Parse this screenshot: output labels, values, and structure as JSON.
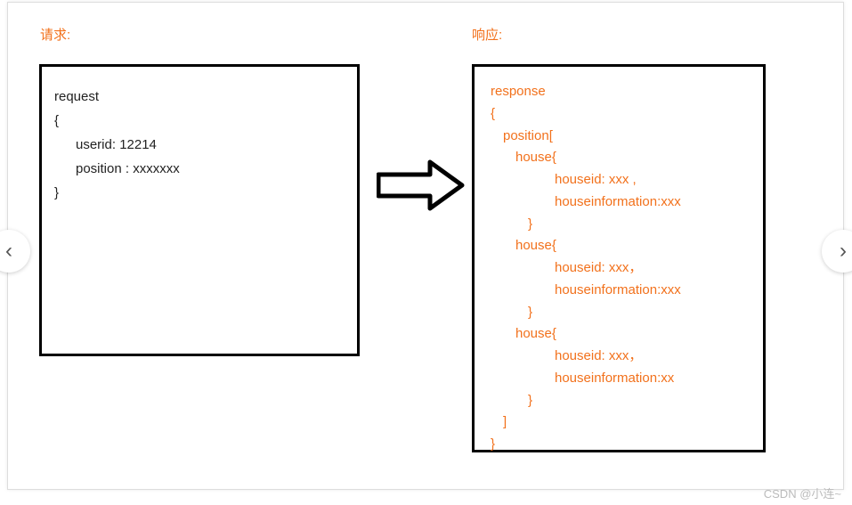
{
  "labels": {
    "request": "请求:",
    "response": "响应:"
  },
  "request": {
    "title": "request",
    "open": "{",
    "userid_line": "userid:  12214",
    "position_line": "position :  xxxxxxx",
    "close": "}"
  },
  "response": {
    "title": "response",
    "open": "{",
    "pos_open": "position[",
    "house1_open": "house{",
    "house1_id": "houseid: xxx ,",
    "house1_info": "houseinformation:xxx",
    "house1_close": "}",
    "house2_open": "house{",
    "house2_id": "houseid: xxx，",
    "house2_info": "houseinformation:xxx",
    "house2_close": "}",
    "house3_open": "house{",
    "house3_id": "houseid: xxx，",
    "house3_info": "houseinformation:xx",
    "house3_close": "}",
    "pos_close": "]",
    "close": "}"
  },
  "nav": {
    "prev": "‹",
    "next": "›"
  },
  "watermark": "CSDN @小连~"
}
